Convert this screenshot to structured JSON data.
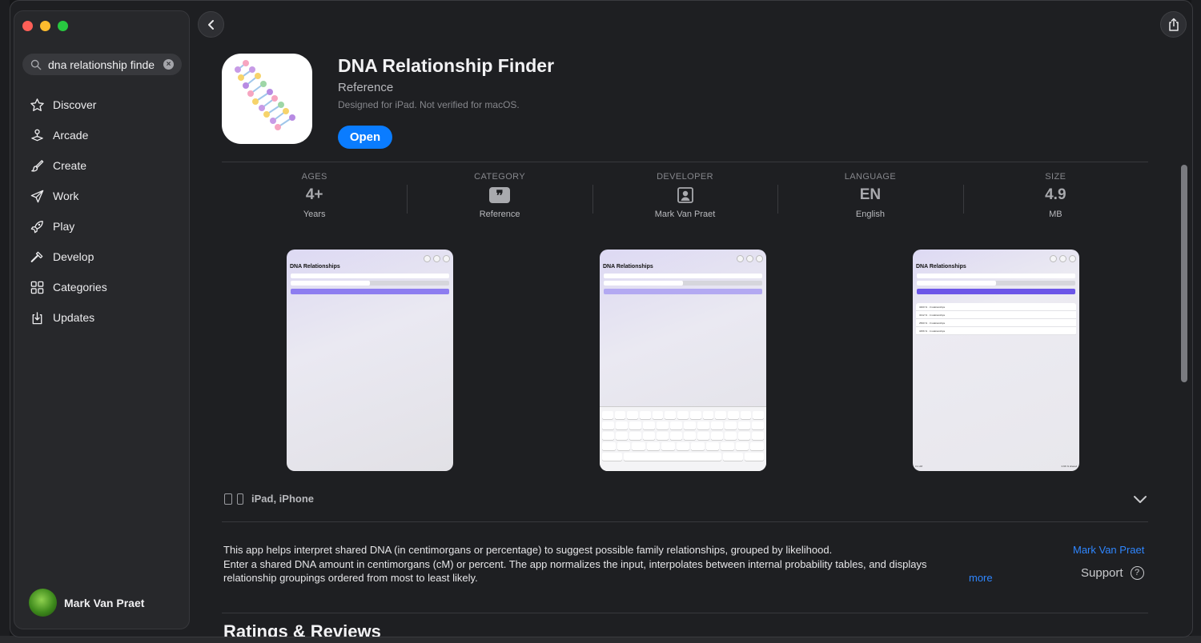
{
  "sidebar": {
    "search": {
      "value": "dna relationship finde"
    },
    "items": [
      {
        "label": "Discover",
        "icon": "star-icon"
      },
      {
        "label": "Arcade",
        "icon": "joystick-icon"
      },
      {
        "label": "Create",
        "icon": "brush-icon"
      },
      {
        "label": "Work",
        "icon": "paperplane-icon"
      },
      {
        "label": "Play",
        "icon": "rocket-icon"
      },
      {
        "label": "Develop",
        "icon": "hammer-icon"
      },
      {
        "label": "Categories",
        "icon": "grid-icon"
      },
      {
        "label": "Updates",
        "icon": "download-icon"
      }
    ],
    "user": {
      "name": "Mark Van Praet"
    }
  },
  "app": {
    "title": "DNA Relationship Finder",
    "category": "Reference",
    "designed_note": "Designed for iPad. Not verified for macOS.",
    "open_label": "Open"
  },
  "stats": [
    {
      "label": "AGES",
      "value": "4+",
      "sub": "Years"
    },
    {
      "label": "CATEGORY",
      "value": "❞",
      "sub": "Reference"
    },
    {
      "label": "DEVELOPER",
      "value": "",
      "sub": "Mark Van Praet"
    },
    {
      "label": "LANGUAGE",
      "value": "EN",
      "sub": "English"
    },
    {
      "label": "SIZE",
      "value": "4.9",
      "sub": "MB"
    }
  ],
  "screenshots": {
    "title": "DNA Relationships",
    "results": [
      "3400 % · 3 relationships",
      "3212 % · 4 relationships",
      "2560 % · 3 relationships",
      "3456 % · 4 relationships"
    ],
    "footer_left": "3.1 cM",
    "footer_right": "0.66 % shared"
  },
  "devices": {
    "label": "iPad, iPhone"
  },
  "description": {
    "line1": "This app helps interpret shared DNA (in centimorgans or percentage) to suggest possible family relationships, grouped by likelihood.",
    "line2": "Enter a shared DNA amount in centimorgans (cM) or percent. The app normalizes the input, interpolates between internal probability tables, and displays relationship groupings ordered from most to least likely.",
    "more": "more"
  },
  "side_links": {
    "developer": "Mark Van Praet",
    "support": "Support"
  },
  "ratings_title": "Ratings & Reviews"
}
